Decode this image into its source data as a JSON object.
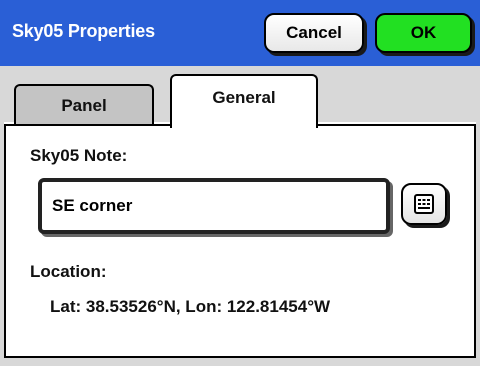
{
  "window": {
    "title": "Sky05 Properties",
    "cancel_label": "Cancel",
    "ok_label": "OK"
  },
  "tabs": [
    {
      "label": "Panel",
      "selected": false
    },
    {
      "label": "General",
      "selected": true
    }
  ],
  "general": {
    "note_label": "Sky05 Note:",
    "note_value": "SE corner",
    "keyboard_icon": "keyboard-icon",
    "location_label": "Location:",
    "location_value": "Lat: 38.53526°N, Lon: 122.81454°W"
  },
  "colors": {
    "titlebar": "#2a5fd6",
    "ok_button": "#22e022",
    "tab_strip": "#d8d8d8"
  }
}
